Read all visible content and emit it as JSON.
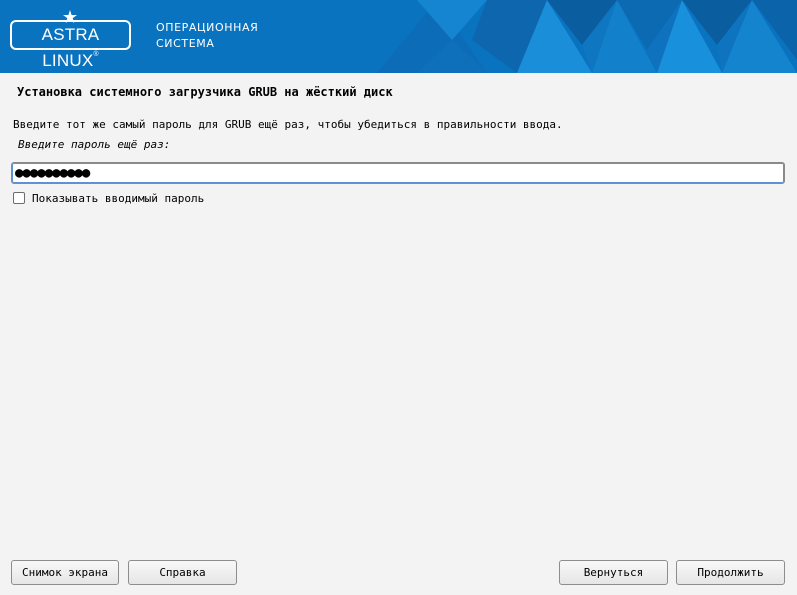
{
  "header": {
    "logo_text": "ASTRA LINUX",
    "logo_reg": "®",
    "os_line1": "ОПЕРАЦИОННАЯ",
    "os_line2": "СИСТЕМА",
    "brand_color": "#0a73c0"
  },
  "main": {
    "title": "Установка системного загрузчика GRUB на жёсткий диск",
    "description": "Введите тот же самый пароль для GRUB ещё раз, чтобы убедиться в правильности ввода.",
    "field_label": "Введите пароль ещё раз:",
    "password_value": "●●●●●●●●●●",
    "show_password_label": "Показывать вводимый пароль",
    "show_password_checked": false
  },
  "footer": {
    "screenshot_label": "Снимок экрана",
    "help_label": "Справка",
    "back_label": "Вернуться",
    "continue_label": "Продолжить"
  }
}
